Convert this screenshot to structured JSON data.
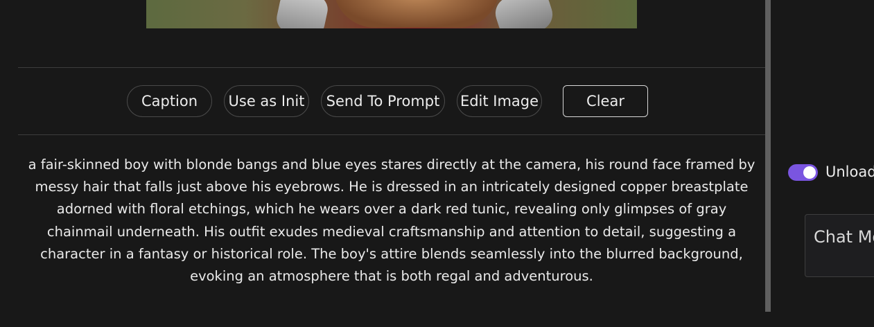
{
  "actions": {
    "caption_label": "Caption",
    "use_as_init_label": "Use as Init",
    "send_to_prompt_label": "Send To Prompt",
    "edit_image_label": "Edit Image",
    "clear_label": "Clear"
  },
  "caption": {
    "text": "a fair-skinned boy with blonde bangs and blue eyes stares directly at the camera, his round face framed by messy hair that falls just above his eyebrows. He is dressed in an intricately designed copper breastplate adorned with floral etchings, which he wears over a dark red tunic, revealing only glimpses of gray chainmail underneath. His outfit exudes medieval craftsmanship and attention to detail, suggesting a character in a fantasy or historical role. The boy's attire blends seamlessly into the blurred background, evoking an atmosphere that is both regal and adventurous."
  },
  "side_panel": {
    "toggle_label": "Unload",
    "toggle_on": true,
    "chat_label": "Chat Mo"
  },
  "colors": {
    "background": "#181818",
    "toggle_accent": "#7a55e0",
    "text": "#eaeaea"
  }
}
